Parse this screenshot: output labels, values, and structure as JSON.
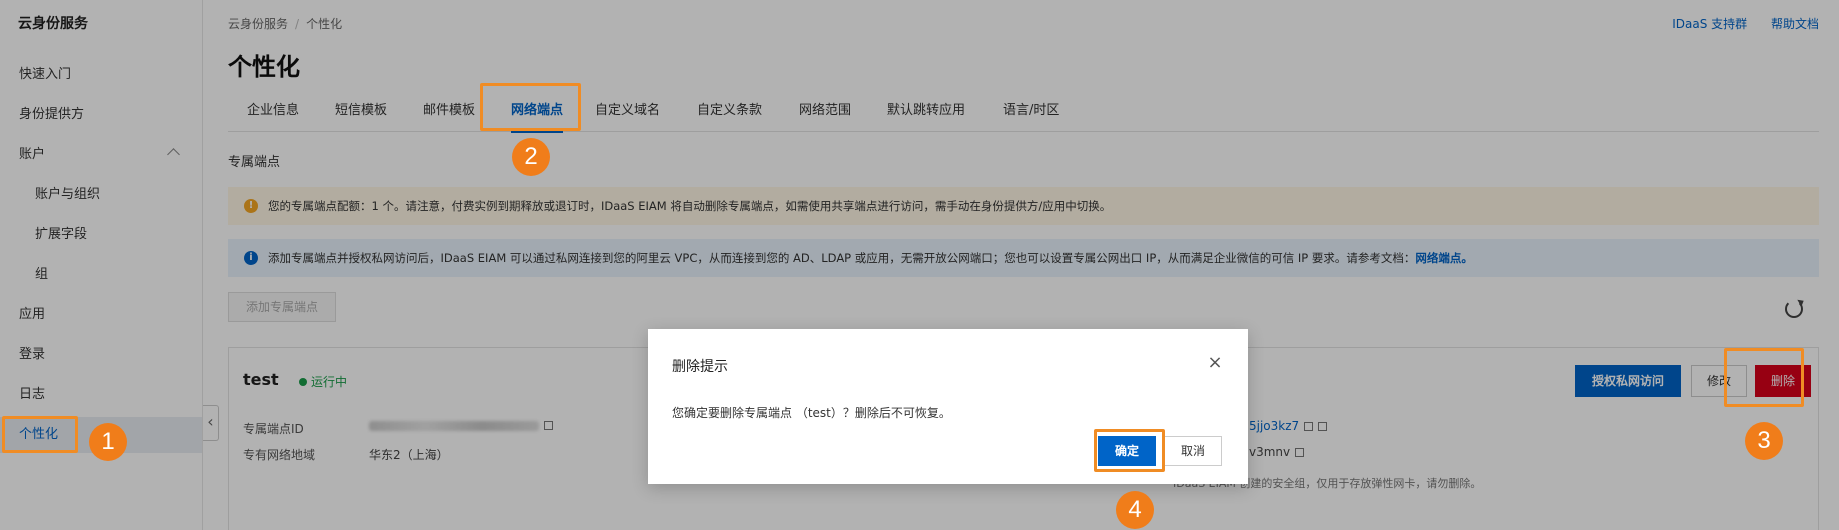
{
  "sidebar": {
    "title": "云身份服务",
    "items": [
      {
        "label": "快速入门"
      },
      {
        "label": "身份提供方"
      },
      {
        "label": "账户"
      },
      {
        "label": "账户与组织"
      },
      {
        "label": "扩展字段"
      },
      {
        "label": "组"
      },
      {
        "label": "应用"
      },
      {
        "label": "登录"
      },
      {
        "label": "日志"
      },
      {
        "label": "个性化"
      }
    ]
  },
  "header": {
    "breadcrumb": [
      "云身份服务",
      "个性化"
    ],
    "links": [
      "IDaaS 支持群",
      "帮助文档"
    ],
    "title": "个性化"
  },
  "tabs": [
    "企业信息",
    "短信模板",
    "邮件模板",
    "网络端点",
    "自定义域名",
    "自定义条款",
    "网络范围",
    "默认跳转应用",
    "语言/时区"
  ],
  "section_title": "专属端点",
  "alerts": {
    "warn_text": "您的专属端点配额：1 个。请注意，付费实例到期释放或退订时，IDaaS EIAM 将自动删除专属端点，如需使用共享端点进行访问，需手动在身份提供方/应用中切换。",
    "info_text": "添加专属端点并授权私网访问后，IDaaS EIAM 可以通过私网连接到您的阿里云 VPC，从而连接到您的 AD、LDAP 或应用，无需开放公网端口；您也可以设置专属公网出口 IP，从而满足企业微信的可信 IP 要求。请参考文档：",
    "info_link": "网络端点。"
  },
  "add_button": "添加专属端点",
  "card": {
    "name": "test",
    "status": "运行中",
    "id_label": "专属端点ID",
    "region_label": "专有网络地域",
    "region_value": "华东2（上海）",
    "right_val_1": "5jjo3kz7",
    "right_val_2": "v3mnv",
    "right_note": "IDaaS EIAM 创建的安全组，仅用于存放弹性网卡，请勿删除。",
    "btn_grant": "授权私网访问",
    "btn_edit": "修改",
    "btn_delete": "删除"
  },
  "dialog": {
    "title": "删除提示",
    "message": "您确定要删除专属端点 （test）？删除后不可恢复。",
    "ok": "确定",
    "cancel": "取消"
  },
  "markers": [
    "1",
    "2",
    "3",
    "4"
  ],
  "colors": {
    "primary": "#0064c8",
    "danger": "#d9001b",
    "highlight": "#f08c24",
    "marker": "#f07d1a"
  }
}
